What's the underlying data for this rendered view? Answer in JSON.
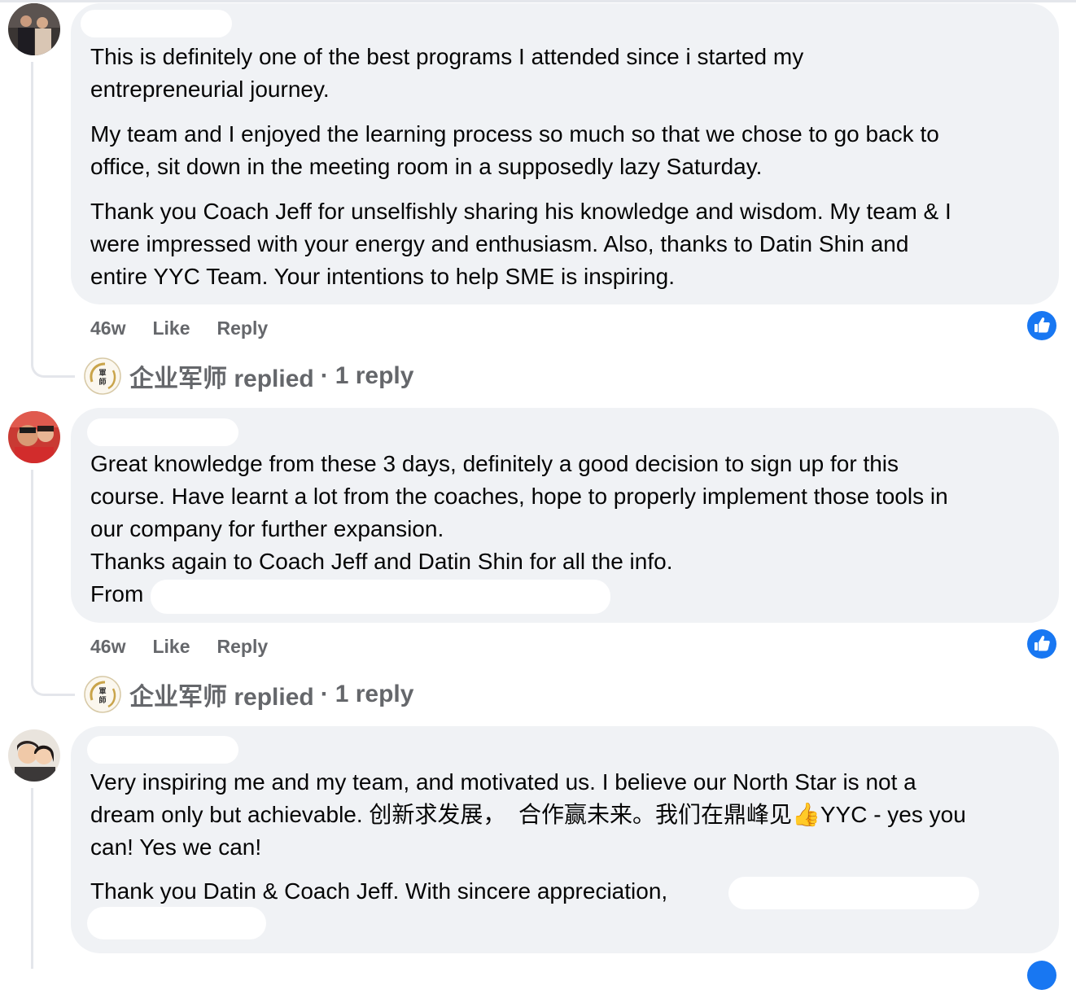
{
  "comments": [
    {
      "paragraphs": [
        "This is definitely one of the best programs I attended since i started my\nentrepreneurial journey.",
        "My team and I enjoyed the learning process so much so that we chose to go back to\noffice, sit down in the meeting room in a supposedly lazy Saturday.",
        "Thank you Coach Jeff for unselfishly sharing his knowledge and wisdom. My team & I\nwere impressed with your energy and enthusiasm. Also, thanks to Datin Shin and\nentire YYC Team. Your intentions to help SME is inspiring."
      ],
      "time": "46w",
      "like_label": "Like",
      "reply_label": "Reply",
      "replied_by": "企业军师 replied",
      "reply_count": "1 reply"
    },
    {
      "paragraphs": [
        "Great knowledge from these 3 days, definitely a good decision to sign up for this\ncourse. Have learnt a lot from the coaches, hope to properly implement those tools in\nour company for further expansion.\nThanks again to Coach Jeff and Datin Shin for all the info.\nFrom"
      ],
      "time": "46w",
      "like_label": "Like",
      "reply_label": "Reply",
      "replied_by": "企业军师 replied",
      "reply_count": "1 reply"
    },
    {
      "paragraphs": [
        "Very inspiring me and my team, and motivated us. I believe our North Star is not a\ndream only but achievable. 创新求发展，  合作赢未来。我们在鼎峰见👍YYC - yes you\ncan! Yes we can!",
        "Thank you Datin & Coach Jeff. With sincere appreciation,"
      ]
    }
  ],
  "reply_separator": "·",
  "colors": {
    "bubble": "#f0f2f5",
    "meta_text": "#65676b",
    "like_blue": "#1877f2",
    "thread_line": "#e4e6eb"
  },
  "icons": {
    "like_badge": "thumbs-up-icon"
  }
}
